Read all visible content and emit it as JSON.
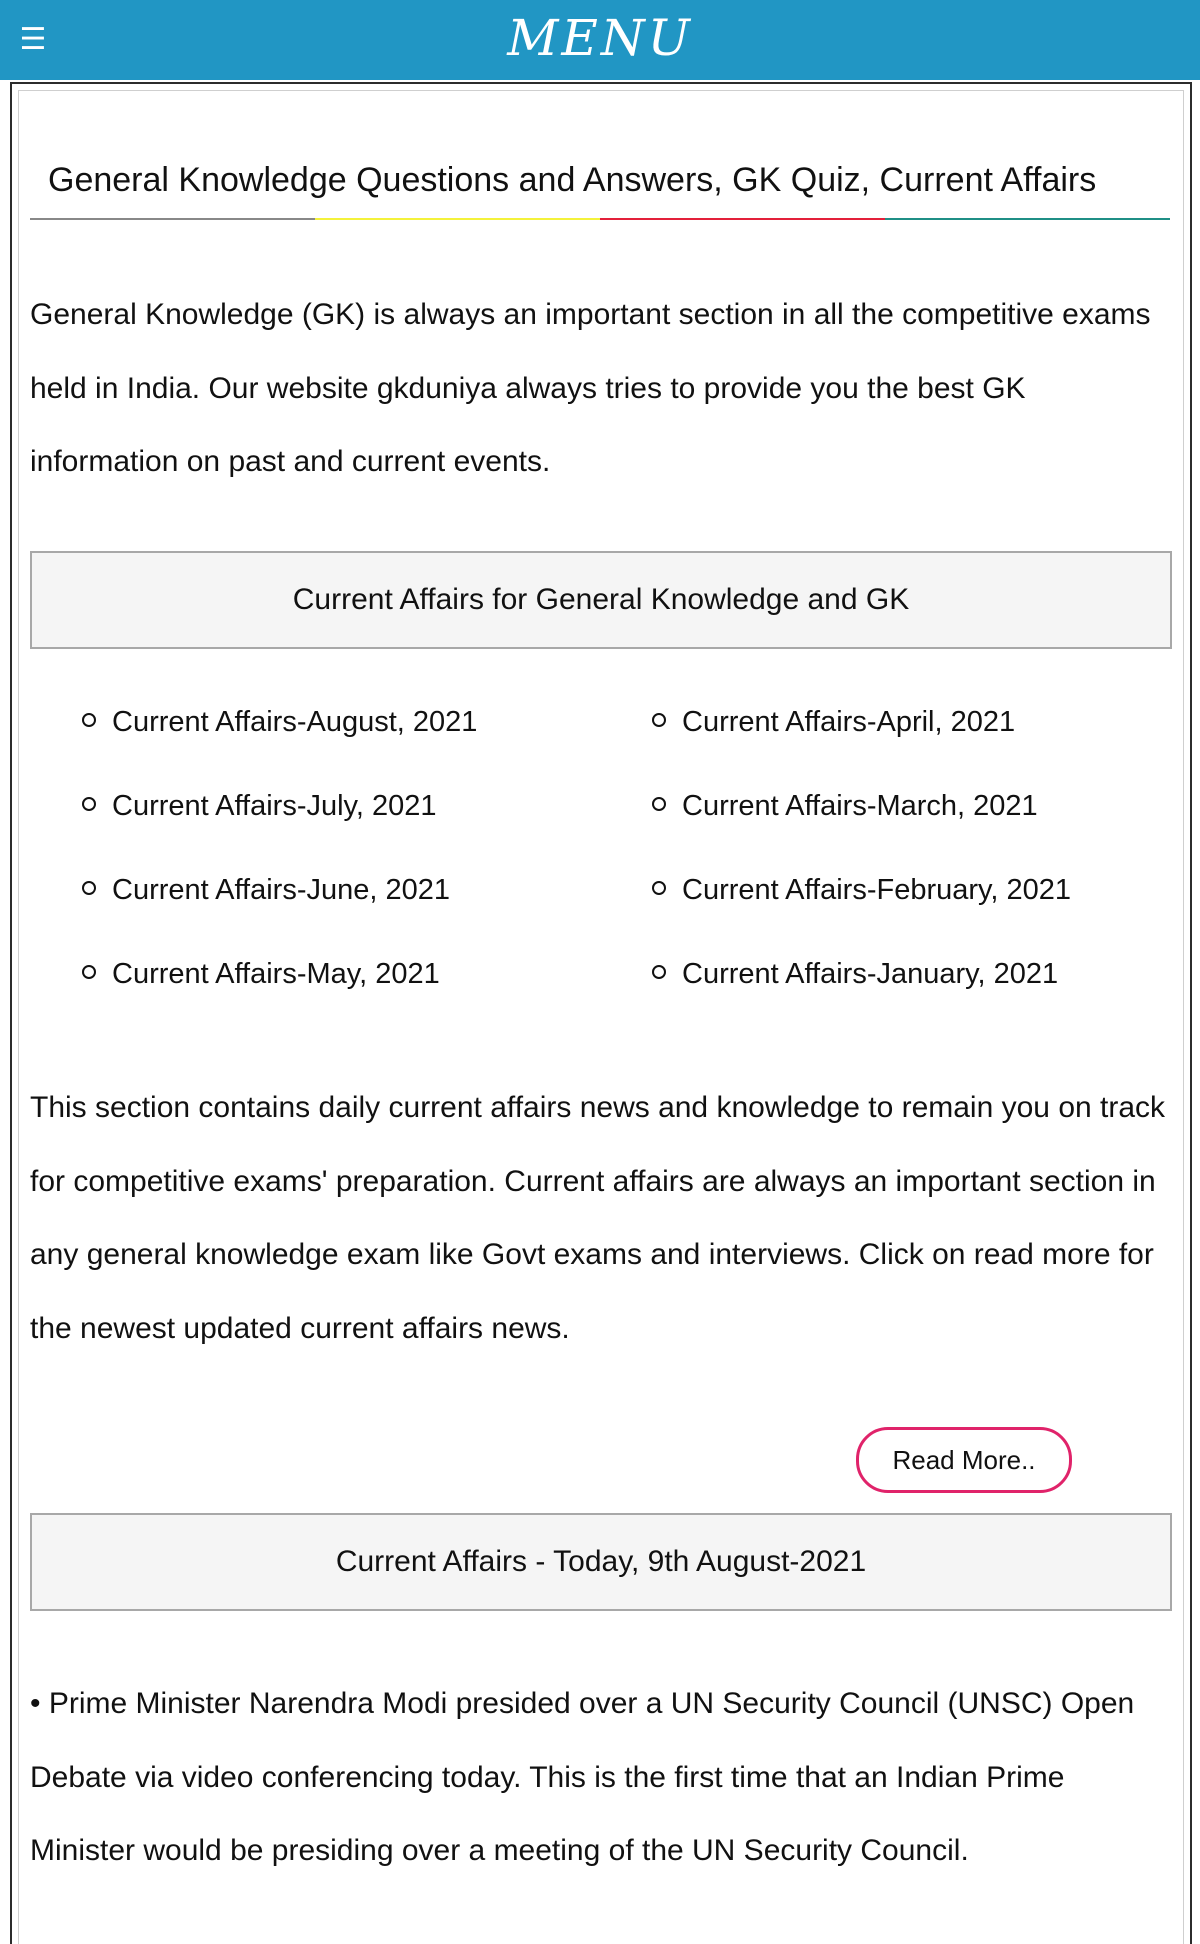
{
  "header": {
    "menu_icon": "hamburger-icon",
    "menu_glyph": "☰",
    "title": "MENU",
    "bg_color": "#2196c4"
  },
  "page": {
    "title": "General Knowledge Questions and Answers, GK Quiz, Current Affairs",
    "title_rule_colors": [
      "#888888",
      "#f4f23b",
      "#e3203a",
      "#1f8f86"
    ],
    "intro": "General Knowledge (GK) is always an important section in all the competitive exams held in India. Our website gkduniya always tries to provide you the best GK information on past and current events."
  },
  "current_affairs_section": {
    "heading": "Current Affairs for General Knowledge and GK",
    "links": [
      "Current Affairs-August, 2021",
      "Current Affairs-April, 2021",
      "Current Affairs-July, 2021",
      "Current Affairs-March, 2021",
      "Current Affairs-June, 2021",
      "Current Affairs-February, 2021",
      "Current Affairs-May, 2021",
      "Current Affairs-January, 2021"
    ],
    "description": "This section contains daily current affairs news and knowledge to remain you on track for competitive exams' preparation. Current affairs are always an important section in any general knowledge exam like Govt exams and interviews. Click on read more for the newest updated current affairs news.",
    "read_more_label": "Read More..",
    "read_more_border_color": "#e0236a"
  },
  "today_section": {
    "heading": "Current Affairs - Today, 9th August-2021",
    "news": "• Prime Minister Narendra Modi presided over a UN Security Council (UNSC) Open Debate via video conferencing today. This is the first time that an Indian Prime Minister would be presiding over a meeting of the UN Security Council."
  }
}
